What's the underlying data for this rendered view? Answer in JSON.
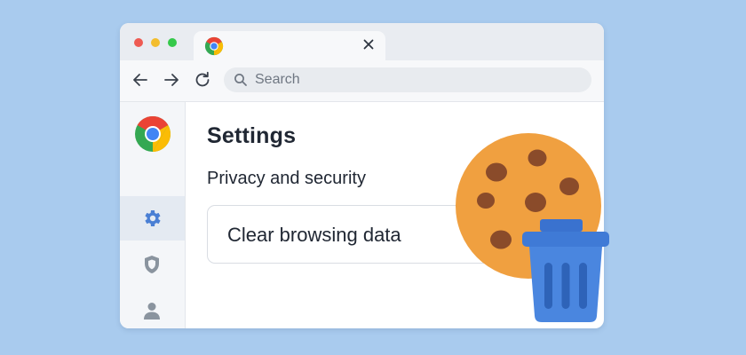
{
  "window": {
    "controls": [
      "close",
      "minimize",
      "maximize"
    ],
    "tab": {
      "favicon": "chrome-logo-icon",
      "close_icon": "close-icon"
    }
  },
  "toolbar": {
    "back_icon": "back-arrow-icon",
    "forward_icon": "forward-arrow-icon",
    "reload_icon": "reload-icon",
    "search": {
      "icon": "search-icon",
      "placeholder": "Search"
    }
  },
  "sidebar": {
    "logo": "chrome-logo-icon",
    "items": [
      {
        "icon": "gear-icon",
        "active": true
      },
      {
        "icon": "shield-icon",
        "active": false
      },
      {
        "icon": "person-icon",
        "active": false
      }
    ]
  },
  "main": {
    "title": "Settings",
    "section_title": "Privacy and security",
    "action_label": "Clear browsing data"
  },
  "illustration": {
    "items": [
      "cookie",
      "trash-can-icon"
    ]
  },
  "colors": {
    "background": "#a9cbee",
    "accent": "#4a7fd4",
    "cookie": "#f0a040",
    "cookie_chips": "#8a4b2a",
    "trash": "#3f7ad6"
  }
}
